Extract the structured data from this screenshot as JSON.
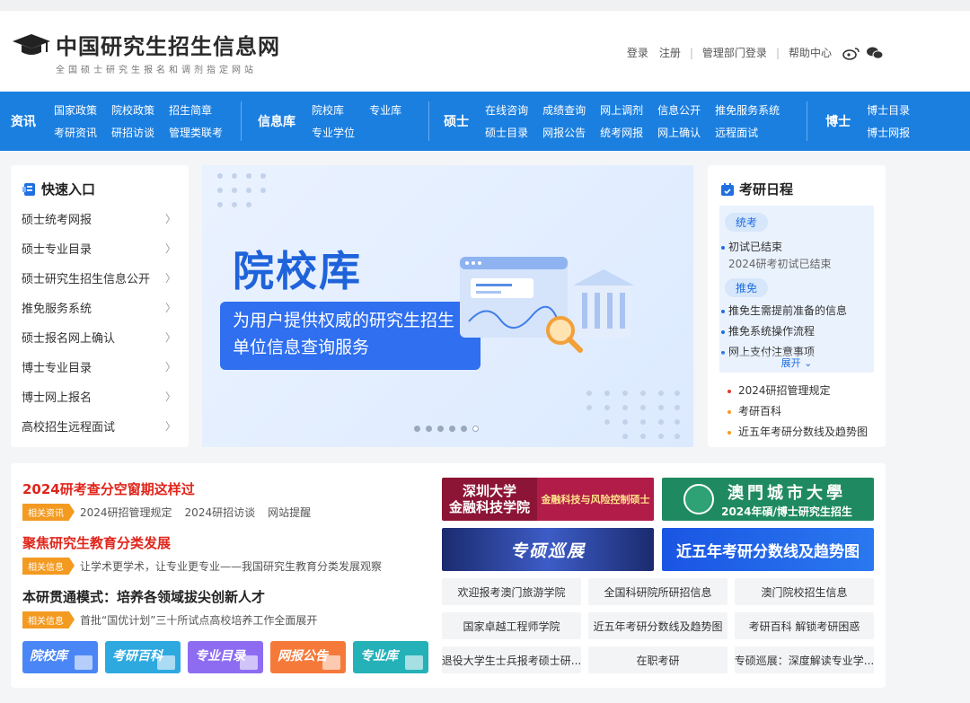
{
  "header": {
    "title": "中国研究生招生信息网",
    "subtitle": "全国硕士研究生报名和调剂指定网站",
    "links": [
      "登录",
      "注册",
      "管理部门登录",
      "帮助中心"
    ]
  },
  "nav": {
    "sections": [
      {
        "head": "资讯",
        "items": [
          "国家政策",
          "院校政策",
          "招生简章",
          "考研资讯",
          "研招访谈",
          "管理类联考"
        ]
      },
      {
        "head": "信息库",
        "items": [
          "院校库",
          "专业库",
          "专业学位"
        ]
      },
      {
        "head": "硕士",
        "items": [
          "在线咨询",
          "成绩查询",
          "网上调剂",
          "信息公开",
          "推免服务系统",
          "硕士目录",
          "网报公告",
          "统考网报",
          "网上确认",
          "远程面试"
        ]
      },
      {
        "head": "博士",
        "items": [
          "博士目录",
          "博士网报"
        ]
      }
    ]
  },
  "quick": {
    "title": "快速入口",
    "items": [
      "硕士统考网报",
      "硕士专业目录",
      "硕士研究生招生信息公开",
      "推免服务系统",
      "硕士报名网上确认",
      "博士专业目录",
      "博士网上报名",
      "高校招生远程面试"
    ]
  },
  "banner": {
    "title": "院校库",
    "line1": "为用户提供权威的研究生招生",
    "line2": "单位信息查询服务",
    "slides": 6,
    "active": 6
  },
  "schedule": {
    "title": "考研日程",
    "group1": {
      "label": "统考",
      "item": "初试已结束",
      "sub": "2024研考初试已结束"
    },
    "group2": {
      "label": "推免",
      "items": [
        "推免生需提前准备的信息",
        "推免系统操作流程",
        "网上支付注意事项"
      ]
    },
    "expand": "展开",
    "list": [
      "2024研招管理规定",
      "考研百科",
      "近五年考研分数线及趋势图"
    ]
  },
  "news": [
    {
      "title": "2024研考查分空窗期这样过",
      "tag": "相关资讯",
      "related": [
        "2024研招管理规定",
        "2024研招访谈",
        "网站提醒"
      ]
    },
    {
      "title": "聚焦研究生教育分类发展",
      "tag": "相关信息",
      "related": [
        "让学术更学术，让专业更专业——我国研究生教育分类发展观察"
      ]
    },
    {
      "title": "本研贯通模式：培养各领域拔尖创新人才",
      "tag": "相关信息",
      "related": [
        "首批“国优计划”三十所试点高校培养工作全面展开"
      ]
    }
  ],
  "quick_buttons": [
    "院校库",
    "考研百科",
    "专业目录",
    "网报公告",
    "专业库"
  ],
  "ads": {
    "sz_left1": "深圳大学",
    "sz_left2": "金融科技学院",
    "sz_right": "金融科技与风险控制硕士",
    "mc_title": "澳門城市大學",
    "mc_sub": "2024年碩/博士研究生招生",
    "zs": "专硕巡展",
    "trend": "近五年考研分数线及趋势图"
  },
  "links": [
    "欢迎报考澳门旅游学院",
    "全国科研院所研招信息",
    "澳门院校招生信息",
    "国家卓越工程师学院",
    "近五年考研分数线及趋势图",
    "考研百科 解锁考研困惑",
    "退役大学生士兵报考硕士研...",
    "在职考研",
    "专硕巡展：深度解读专业学..."
  ]
}
